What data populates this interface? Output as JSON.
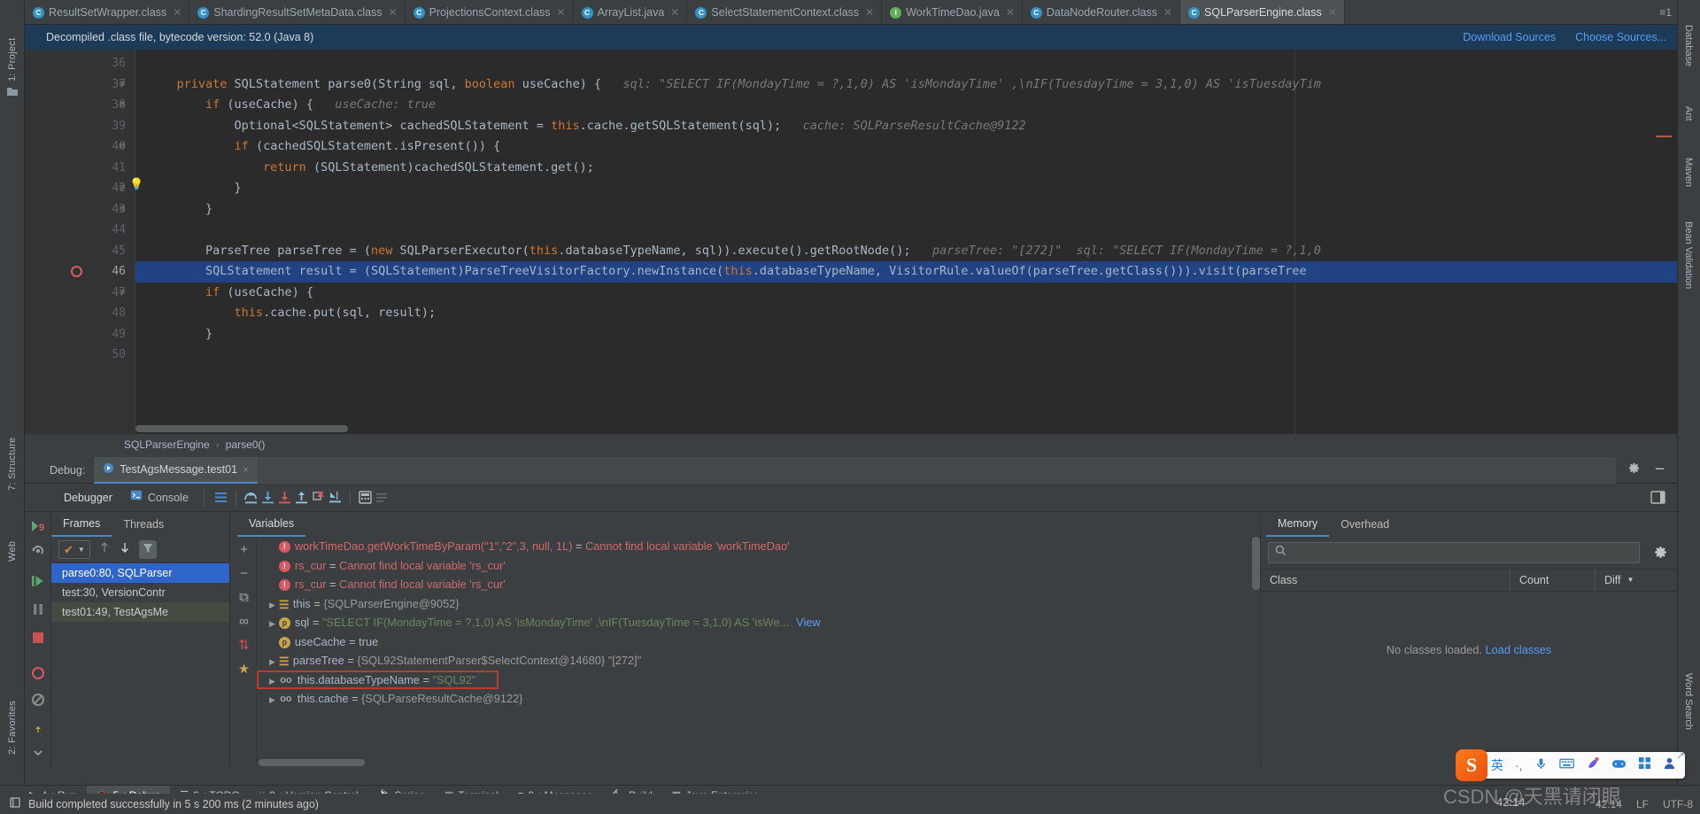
{
  "window": {
    "notice": "Decompiled .class file, bytecode version: 52.0 (Java 8)",
    "download_sources": "Download Sources",
    "choose_sources": "Choose Sources..."
  },
  "editor_tabs": [
    {
      "label": "ResultSetWrapper.class",
      "icon": "class-icon",
      "active": false
    },
    {
      "label": "ShardingResultSetMetaData.class",
      "icon": "class-icon",
      "active": false
    },
    {
      "label": "ProjectionsContext.class",
      "icon": "class-icon",
      "active": false
    },
    {
      "label": "ArrayList.java",
      "icon": "class-icon",
      "active": false
    },
    {
      "label": "SelectStatementContext.class",
      "icon": "class-icon",
      "active": false
    },
    {
      "label": "WorkTimeDao.java",
      "icon": "interface-icon",
      "active": false
    },
    {
      "label": "DataNodeRouter.class",
      "icon": "class-icon",
      "active": false
    },
    {
      "label": "SQLParserEngine.class",
      "icon": "class-icon",
      "active": true
    }
  ],
  "tab_overflow": "≡1",
  "left_tool_tabs": [
    {
      "label": "1: Project"
    },
    {
      "label": "7: Structure"
    },
    {
      "label": "Web"
    },
    {
      "label": "2: Favorites"
    }
  ],
  "right_tool_tabs": [
    {
      "label": "Database"
    },
    {
      "label": "Ant"
    },
    {
      "label": "Maven"
    },
    {
      "label": "Bean Validation"
    },
    {
      "label": "Word Search"
    }
  ],
  "code": {
    "first_line": 36,
    "lines": [
      {
        "num": 36,
        "text": "",
        "fold": "",
        "selected": false
      },
      {
        "num": 37,
        "fold": "-",
        "selected": false,
        "segments": [
          {
            "t": "    ",
            "c": "plain"
          },
          {
            "t": "private",
            "c": "kw"
          },
          {
            "t": " SQLStatement parse0(",
            "c": "plain"
          },
          {
            "t": "String",
            "c": "plain"
          },
          {
            "t": " sql, ",
            "c": "plain"
          },
          {
            "t": "boolean",
            "c": "kw"
          },
          {
            "t": " useCache) {",
            "c": "plain"
          },
          {
            "t": "   sql: \"SELECT IF(MondayTime = ?,1,0) AS 'isMondayTime' ,\\nIF(TuesdayTime = 3,1,0) AS 'isTuesdayTim",
            "c": "hint"
          }
        ]
      },
      {
        "num": 38,
        "fold": "-",
        "selected": false,
        "segments": [
          {
            "t": "        ",
            "c": "plain"
          },
          {
            "t": "if",
            "c": "kw"
          },
          {
            "t": " (useCache) {",
            "c": "plain"
          },
          {
            "t": "   useCache: true",
            "c": "hint"
          }
        ]
      },
      {
        "num": 39,
        "fold": "",
        "selected": false,
        "segments": [
          {
            "t": "            Optional<SQLStatement> cachedSQLStatement = ",
            "c": "plain"
          },
          {
            "t": "this",
            "c": "kw"
          },
          {
            "t": ".cache.getSQLStatement(sql);",
            "c": "plain"
          },
          {
            "t": "   cache: SQLParseResultCache@9122",
            "c": "hint"
          }
        ]
      },
      {
        "num": 40,
        "fold": "-",
        "selected": false,
        "segments": [
          {
            "t": "            ",
            "c": "plain"
          },
          {
            "t": "if",
            "c": "kw"
          },
          {
            "t": " (cachedSQLStatement.isPresent()) {",
            "c": "plain"
          }
        ]
      },
      {
        "num": 41,
        "fold": "",
        "selected": false,
        "segments": [
          {
            "t": "                ",
            "c": "plain"
          },
          {
            "t": "return",
            "c": "kw"
          },
          {
            "t": " (SQLStatement)cachedSQLStatement.get();",
            "c": "plain"
          }
        ]
      },
      {
        "num": 42,
        "fold": "-",
        "selected": false,
        "bulb": true,
        "segments": [
          {
            "t": "            }",
            "c": "plain"
          }
        ]
      },
      {
        "num": 43,
        "fold": "-",
        "selected": false,
        "segments": [
          {
            "t": "        }",
            "c": "plain"
          }
        ]
      },
      {
        "num": 44,
        "fold": "",
        "selected": false,
        "segments": []
      },
      {
        "num": 45,
        "fold": "",
        "selected": false,
        "segments": [
          {
            "t": "        ParseTree parseTree = (",
            "c": "plain"
          },
          {
            "t": "new",
            "c": "kw"
          },
          {
            "t": " SQLParserExecutor(",
            "c": "plain"
          },
          {
            "t": "this",
            "c": "kw"
          },
          {
            "t": ".databaseTypeName, sql)).execute().getRootNode();",
            "c": "plain"
          },
          {
            "t": "   parseTree: \"[272]\"  sql: \"SELECT IF(MondayTime = ?,1,0",
            "c": "hint"
          }
        ]
      },
      {
        "num": 46,
        "fold": "",
        "selected": true,
        "breakpoint": true,
        "segments": [
          {
            "t": "        SQLStatement result = (SQLStatement)ParseTreeVisitorFactory.newInstance(",
            "c": "plain"
          },
          {
            "t": "this",
            "c": "kw"
          },
          {
            "t": ".databaseTypeName, VisitorRule.valueOf(parseTree.getClass())).visit(parseTree",
            "c": "plain"
          }
        ]
      },
      {
        "num": 47,
        "fold": "-",
        "selected": false,
        "segments": [
          {
            "t": "        ",
            "c": "plain"
          },
          {
            "t": "if",
            "c": "kw"
          },
          {
            "t": " (useCache) {",
            "c": "plain"
          }
        ]
      },
      {
        "num": 48,
        "fold": "",
        "selected": false,
        "segments": [
          {
            "t": "            ",
            "c": "plain"
          },
          {
            "t": "this",
            "c": "kw"
          },
          {
            "t": ".cache.put(sql, result);",
            "c": "plain"
          }
        ]
      },
      {
        "num": 49,
        "fold": "",
        "selected": false,
        "segments": [
          {
            "t": "        }",
            "c": "plain"
          }
        ]
      },
      {
        "num": 50,
        "fold": "",
        "selected": false,
        "segments": []
      }
    ]
  },
  "breadcrumb": {
    "class": "SQLParserEngine",
    "separator": "›",
    "method": "parse0()"
  },
  "debug_header": {
    "label": "Debug:",
    "config_name": "TestAgsMessage.test01",
    "close": "×",
    "settings_icon": "gear-icon",
    "minimize_icon": "minimize-icon"
  },
  "debug_toolbar": {
    "tabs": [
      {
        "label": "Debugger",
        "active": true,
        "icon": ""
      },
      {
        "label": "Console",
        "active": false,
        "icon": "console-icon"
      }
    ],
    "buttons": [
      {
        "name": "show-execution-point-icon"
      },
      {
        "name": "step-over-icon"
      },
      {
        "name": "step-into-icon"
      },
      {
        "name": "force-step-into-icon"
      },
      {
        "name": "step-out-icon"
      },
      {
        "name": "drop-frame-icon"
      },
      {
        "name": "run-to-cursor-icon"
      },
      {
        "name": "evaluate-expression-icon"
      },
      {
        "name": "mute-breakpoints-icon"
      }
    ],
    "layout_icon": "layout-settings-icon"
  },
  "side_tools": [
    {
      "name": "rerun-icon"
    },
    {
      "name": "rerun-failed-icon"
    },
    {
      "name": "resume-program-icon"
    },
    {
      "name": "pause-program-icon"
    },
    {
      "name": "stop-icon"
    },
    {
      "name": "view-breakpoints-icon"
    },
    {
      "name": "mute-breakpoints-icon"
    },
    {
      "name": "pin-icon"
    },
    {
      "name": "settings-icon"
    },
    {
      "name": "more-icon"
    }
  ],
  "frames_panel": {
    "tabs": [
      {
        "label": "Frames",
        "active": true
      },
      {
        "label": "Threads",
        "active": false
      }
    ],
    "thread_selector": "✔",
    "up_icon": "arrow-up-icon",
    "down_icon": "arrow-down-icon",
    "filter_icon": "filter-icon",
    "frames": [
      {
        "label": "parse0:80, SQLParser",
        "state": "selected"
      },
      {
        "label": "test:30, VersionContr",
        "state": "normal"
      },
      {
        "label": "test01:49, TestAgsMe",
        "state": "tinted"
      }
    ]
  },
  "variables_panel": {
    "tab_label": "Variables",
    "toolbar": [
      {
        "name": "add-watch-button",
        "glyph": "+"
      },
      {
        "name": "remove-watch-button",
        "glyph": "−"
      },
      {
        "name": "copy-button",
        "glyph": "⧉"
      },
      {
        "name": "inspect-button",
        "glyph": "∞"
      },
      {
        "name": "sort-button",
        "glyph": "⇅"
      },
      {
        "name": "star-button",
        "glyph": "★"
      }
    ],
    "rows": [
      {
        "indent": 0,
        "expander": "",
        "badge": "err",
        "name": "workTimeDao.getWorkTimeByParam(\"1\",\"2\",3, null, 1L)",
        "eq": " = ",
        "value": "Cannot find local variable 'workTimeDao'",
        "value_kind": "error"
      },
      {
        "indent": 0,
        "expander": "",
        "badge": "err",
        "name": "rs_cur",
        "eq": " = ",
        "value": "Cannot find local variable 'rs_cur'",
        "value_kind": "error"
      },
      {
        "indent": 0,
        "expander": "",
        "badge": "err",
        "name": "rs_cur",
        "eq": " = ",
        "value": "Cannot find local variable 'rs_cur'",
        "value_kind": "error"
      },
      {
        "indent": 0,
        "expander": "▶",
        "badge": "fld",
        "name": "this",
        "eq": " = ",
        "value": "{SQLParserEngine@9052}",
        "value_kind": "object"
      },
      {
        "indent": 0,
        "expander": "▶",
        "badge": "p",
        "name": "sql",
        "eq": " = ",
        "value": "\"SELECT IF(MondayTime = ?,1,0) AS 'isMondayTime' ,\\nIF(TuesdayTime = 3,1,0) AS 'isWe...",
        "value_kind": "string",
        "link": "View"
      },
      {
        "indent": 0,
        "expander": "",
        "badge": "p",
        "name": "useCache",
        "eq": " = ",
        "value": "true",
        "value_kind": "plain"
      },
      {
        "indent": 0,
        "expander": "▶",
        "badge": "fld",
        "name": "parseTree",
        "eq": " = ",
        "value": "{SQL92StatementParser$SelectContext@14680} \"[272]\"",
        "value_kind": "object"
      },
      {
        "indent": 0,
        "expander": "▶",
        "badge": "oo",
        "name": "this.databaseTypeName",
        "eq": " = ",
        "value": "\"SQL92\"",
        "value_kind": "string",
        "highlighted": true
      },
      {
        "indent": 0,
        "expander": "▶",
        "badge": "oo",
        "name": "this.cache",
        "eq": " = ",
        "value": "{SQLParseResultCache@9122}",
        "value_kind": "object"
      }
    ]
  },
  "memory_panel": {
    "tabs": [
      {
        "label": "Memory",
        "active": true
      },
      {
        "label": "Overhead",
        "active": false
      }
    ],
    "search_placeholder": "",
    "search_icon": "search-icon",
    "settings_icon": "gear-icon",
    "columns": [
      "Class",
      "Count",
      "Diff"
    ],
    "sort_icon": "chevron-down-icon",
    "empty_text": "No classes loaded.",
    "empty_link": "Load classes"
  },
  "bottom_bar": [
    {
      "num": "4",
      "label": ": Run",
      "icon": "run-icon",
      "active": false
    },
    {
      "num": "5",
      "label": ": Debug",
      "icon": "debug-bug-icon",
      "active": true
    },
    {
      "num": "6",
      "label": ": TODO",
      "icon": "todo-icon",
      "active": false
    },
    {
      "num": "9",
      "label": ": Version Control",
      "icon": "vcs-icon",
      "active": false
    },
    {
      "num": "",
      "label": "Spring",
      "icon": "spring-leaf-icon",
      "active": false
    },
    {
      "num": "",
      "label": "Terminal",
      "icon": "terminal-icon",
      "active": false
    },
    {
      "num": "0",
      "label": ": Messages",
      "icon": "messages-icon",
      "active": false
    },
    {
      "num": "",
      "label": "Build",
      "icon": "build-hammer-icon",
      "active": false
    },
    {
      "num": "",
      "label": "Java Enterprise",
      "icon": "java-enterprise-icon",
      "active": false
    }
  ],
  "status": {
    "icon": "event-log-icon",
    "message": "Build completed successfully in 5 s 200 ms (2 minutes ago)",
    "right": [
      "42:14",
      "LF",
      "UTF-8"
    ]
  },
  "ime": {
    "logo": "S",
    "items": [
      "英",
      "·,",
      "mic-icon",
      "keyboard-icon",
      "skin-icon",
      "game-icon",
      "apps-icon",
      "user-icon"
    ]
  },
  "watermark": "CSDN @天黑请闭眼",
  "colors": {
    "accent_blue": "#4a88c7",
    "selection_blue": "#214283",
    "frame_selected": "#2f65ca",
    "error_red": "#cf6a6a",
    "string_green": "#6a8759",
    "keyword_orange": "#cc7832",
    "link_blue": "#589df6",
    "notice_bg": "#1d3a56",
    "editor_bg": "#2b2b2b",
    "panel_bg": "#3c3f41",
    "highlight_box": "#c0392b"
  }
}
